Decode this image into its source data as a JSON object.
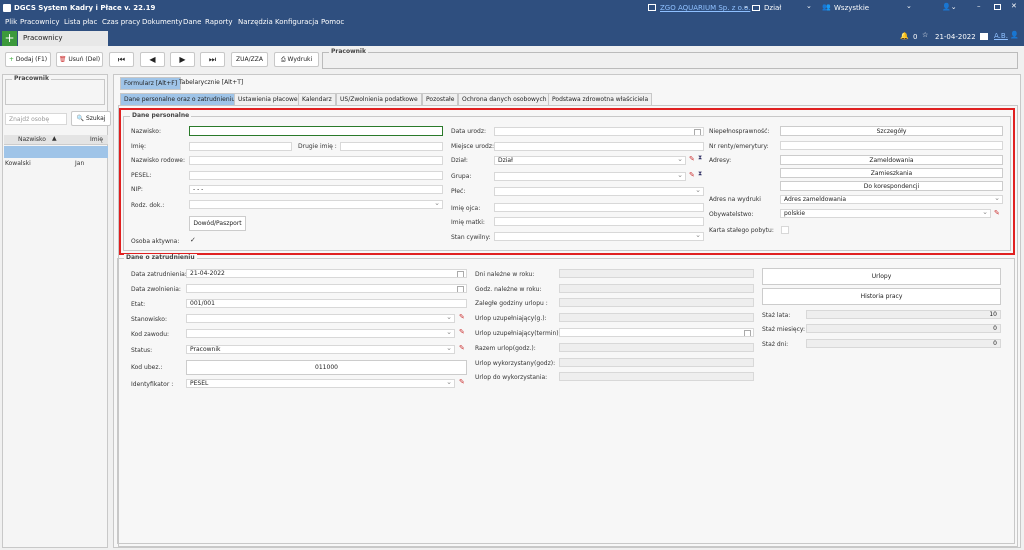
{
  "app": {
    "title": "DGCS System Kadry i Płace v. 22.19",
    "company": "ZGO AQUARIUM Sp. z o.o.",
    "dept": "Dział",
    "scope": "Wszystkie",
    "user": "A.B.",
    "date": "21-04-2022",
    "notif": "0"
  },
  "menu": [
    "Plik",
    "Pracownicy",
    "Lista płac",
    "Czas pracy",
    "Dokumenty",
    "Dane",
    "Raporty",
    "Narzędzia",
    "Konfiguracja",
    "Pomoc"
  ],
  "tab": "Pracownicy",
  "toolbar": {
    "add": "Dodaj (F1)",
    "remove": "Usuń (Del)",
    "zua": "ZUA/ZZA",
    "print": "Wydruki",
    "pracownik_label": "Pracownik"
  },
  "left": {
    "group": "Pracownik",
    "search_placeholder": "Znajdź osobę",
    "search_btn": "Szukaj",
    "col1": "Nazwisko",
    "col2": "Imię",
    "row": {
      "surname": "Kowalski",
      "name": "Jan"
    }
  },
  "viewtabs": [
    "Formularz [Alt+F]",
    "Tabelarycznie [Alt+T]"
  ],
  "subtabs": [
    "Dane personalne oraz o zatrudnieniu",
    "Ustawienia płacowe",
    "Kalendarz",
    "US/Zwolnienia podatkowe",
    "Pozostałe",
    "Ochrona danych osobowych",
    "Podstawa zdrowotna właściciela"
  ],
  "personal": {
    "title": "Dane personalne",
    "nazwisko": "Nazwisko:",
    "imie": "Imię:",
    "drugie": "Drugie imię :",
    "rodowe": "Nazwisko rodowe:",
    "pesel": "PESEL:",
    "nip": "NIP:",
    "nip_val": "-  -  -",
    "rodz": "Rodz. dok.:",
    "dowod_btn": "Dowód/Paszport",
    "aktywna": "Osoba aktywna:",
    "data_ur": "Data urodz:",
    "miejsce": "Miejsce urodz:",
    "dzial": "Dział:",
    "dzial_val": "Dział",
    "grupa": "Grupa:",
    "plec": "Płeć:",
    "imie_ojca": "Imię ojca:",
    "imie_matki": "Imię matki:",
    "stan": "Stan cywilny:",
    "niepeln": "Niepełnosprawność:",
    "szczegoly": "Szczegóły",
    "renty": "Nr renty/emerytury:",
    "adresy": "Adresy:",
    "zameld": "Zameldowania",
    "zamiesz": "Zamieszkania",
    "koresp": "Do korespondencji",
    "adres_wydr": "Adres na wydruki",
    "adres_wydr_val": "Adres zameldowania",
    "obyw": "Obywatelstwo:",
    "obyw_val": "polskie",
    "karta": "Karta stałego pobytu:"
  },
  "employment": {
    "title": "Dane o zatrudnieniu",
    "data_zatr": "Data zatrudnienia:",
    "data_zatr_val": "21-04-2022",
    "data_zwol": "Data zwolnienia:",
    "etat": "Etat:",
    "etat_val": "001/001",
    "stanowisko": "Stanowisko:",
    "kod_zaw": "Kod zawodu:",
    "status": "Status:",
    "status_val": "Pracownik",
    "kod_ubez": "Kod ubez.:",
    "kod_ubez_val": "011000",
    "ident": "Identyfikator :",
    "ident_val": "PESEL",
    "dni_nal": "Dni należne w roku:",
    "godz_nal": "Godz. należne w roku:",
    "zalegle": "Zaległe godziny urlopu :",
    "urlop_uzup_g": "Urlop uzupełniający(g.):",
    "urlop_uzup_t": "Urlop uzupełniający(termin):",
    "razem": "Razem urlop(godz.):",
    "wykorz": "Urlop wykorzystany(godz):",
    "do_wykorz": "Urlop do wykorzystania:",
    "urlopy": "Urlopy",
    "historia": "Historia pracy",
    "staz_lata": "Staż lata:",
    "staz_lata_val": "10",
    "staz_mies": "Staż miesięcy:",
    "staz_mies_val": "0",
    "staz_dni": "Staż dni:",
    "staz_dni_val": "0"
  },
  "colors": {
    "title": "#2f4f7f",
    "highlight": "#e02020",
    "tab_active": "#9fc4e8"
  }
}
